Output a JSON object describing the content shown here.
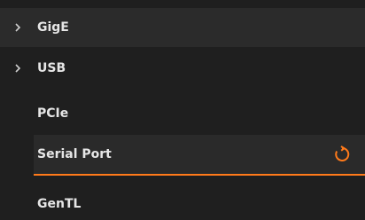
{
  "tree": {
    "items": [
      {
        "label": "GigE",
        "expander_icon": "chevron-right-icon"
      },
      {
        "label": "USB",
        "expander_icon": "chevron-right-icon"
      },
      {
        "label": "PCIe"
      },
      {
        "label": "Serial Port",
        "selected": true,
        "action_icon": "refresh-icon"
      },
      {
        "label": "GenTL"
      }
    ]
  },
  "colors": {
    "background": "#1f1f1f",
    "row_highlight": "#2b2b2b",
    "accent": "#ff7a1a",
    "text": "#e6e6e6"
  }
}
